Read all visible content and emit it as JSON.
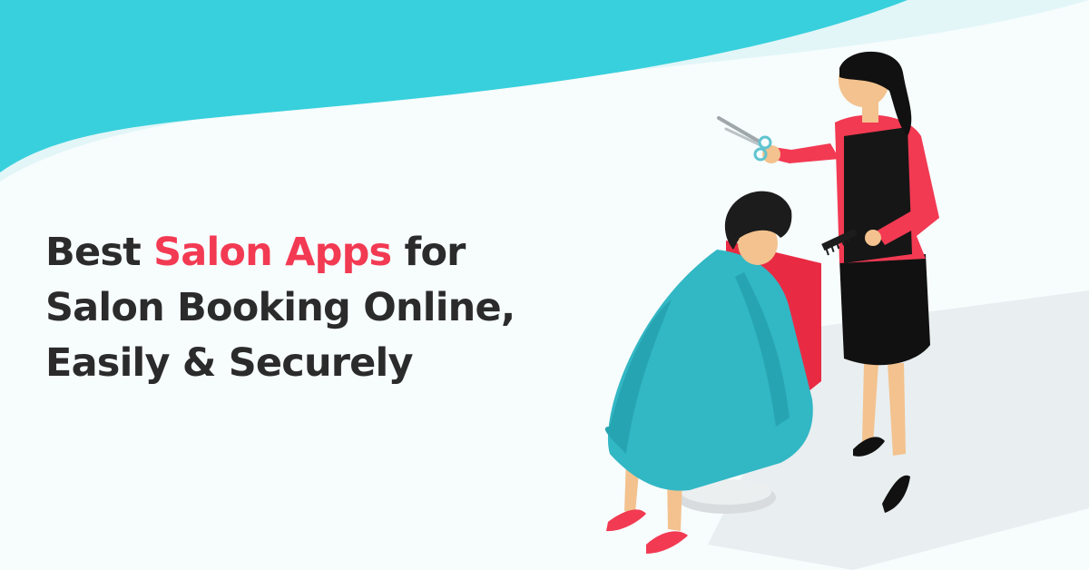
{
  "headline": {
    "line1_prefix": "Best",
    "line1_accent": "Salon Apps",
    "line1_suffix": "for",
    "line2": "Salon Booking Online,",
    "line3": "Easily & Securely"
  },
  "colors": {
    "teal_wave": "#38d0dc",
    "accent_red": "#f23a52",
    "text_dark": "#2b2b2b",
    "background": "#f7fcfd"
  },
  "illustration": {
    "subject": "hairdresser cutting hair of seated customer",
    "icons": [
      "scissors-icon",
      "comb-icon",
      "salon-chair"
    ]
  }
}
